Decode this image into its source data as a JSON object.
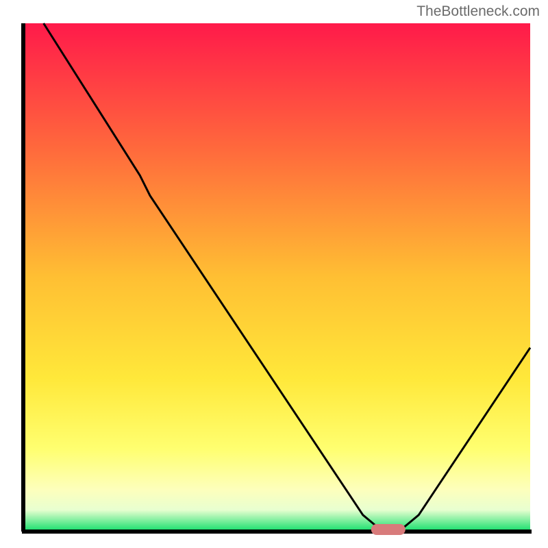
{
  "watermark": "TheBottleneck.com",
  "chart_data": {
    "type": "line",
    "title": "",
    "xlabel": "",
    "ylabel": "",
    "xlim": [
      0,
      100
    ],
    "ylim": [
      0,
      100
    ],
    "optimal_marker": {
      "x": 72,
      "y": 0,
      "color": "#d87b7b"
    },
    "gradient_stops": [
      {
        "offset": 0,
        "color": "#ff1a4a"
      },
      {
        "offset": 25,
        "color": "#ff6a3c"
      },
      {
        "offset": 50,
        "color": "#ffbf33"
      },
      {
        "offset": 70,
        "color": "#ffe83a"
      },
      {
        "offset": 84,
        "color": "#ffff70"
      },
      {
        "offset": 92,
        "color": "#fdffbc"
      },
      {
        "offset": 96,
        "color": "#e8ffd0"
      },
      {
        "offset": 100,
        "color": "#1ee070"
      }
    ],
    "curve": [
      {
        "x": 4,
        "y": 100
      },
      {
        "x": 23,
        "y": 70
      },
      {
        "x": 25,
        "y": 66
      },
      {
        "x": 67,
        "y": 3
      },
      {
        "x": 70,
        "y": 0.5
      },
      {
        "x": 75,
        "y": 0.5
      },
      {
        "x": 78,
        "y": 3
      },
      {
        "x": 100,
        "y": 36
      }
    ]
  }
}
